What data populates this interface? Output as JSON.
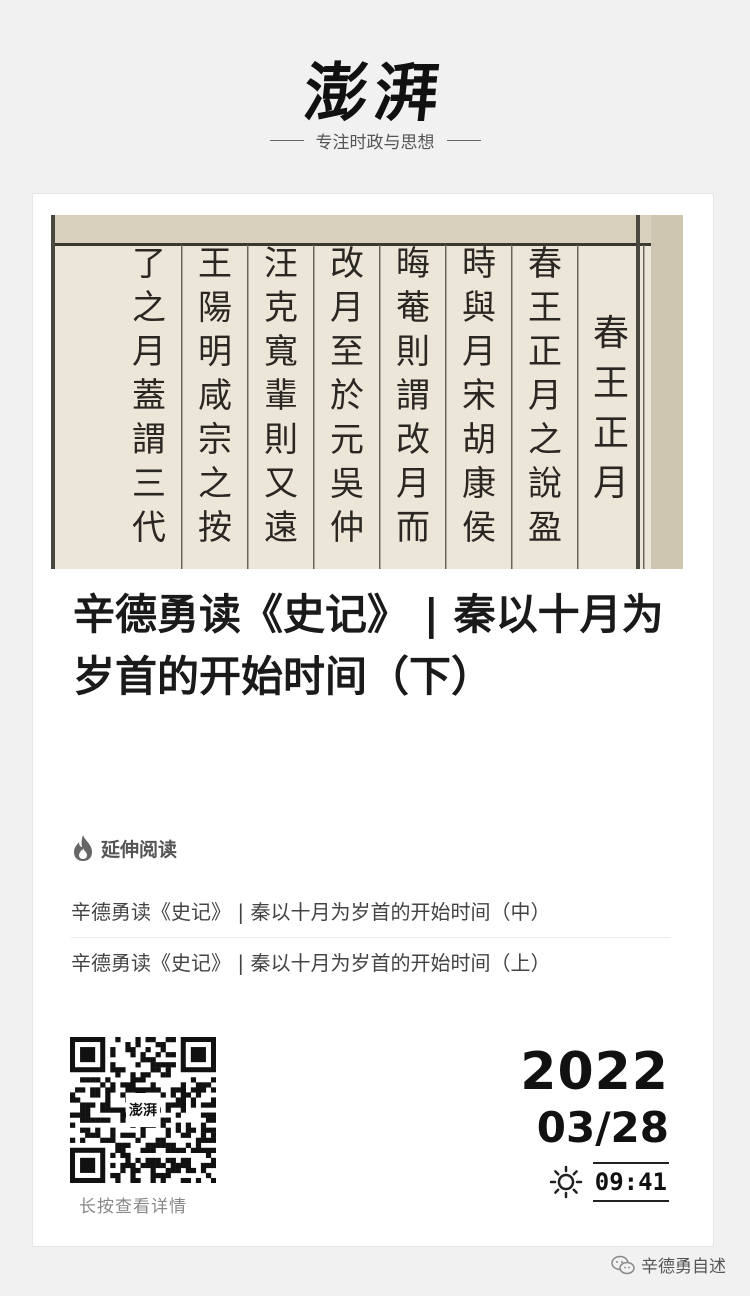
{
  "masthead": {
    "logo_text": "澎湃",
    "slogan": "专注时政与思想"
  },
  "cover": {
    "image_description_icon": "classical-chinese-text-photo",
    "columns": [
      "春王正月",
      "春王正月之說盈",
      "時與月宋胡康侯",
      "晦菴則謂改月而",
      "改月至於元吳仲",
      "汪克寬輩則又遠",
      "王陽明咸宗之按",
      "了之月蓋謂三代"
    ]
  },
  "headline": "辛德勇读《史记》 | 秦以十月为岁首的开始时间（下）",
  "related": {
    "label": "延伸阅读",
    "icon": "flame-icon",
    "items": [
      "辛德勇读《史记》 | 秦以十月为岁首的开始时间（中）",
      "辛德勇读《史记》 | 秦以十月为岁首的开始时间（上）"
    ]
  },
  "qr": {
    "caption": "长按查看详情",
    "center_text": "澎湃"
  },
  "date": {
    "year": "2022",
    "month_day": "03/28",
    "time": "09:41",
    "weather_icon": "sun-icon"
  },
  "watermark": {
    "icon": "wechat-icon",
    "text": "辛德勇自述"
  }
}
